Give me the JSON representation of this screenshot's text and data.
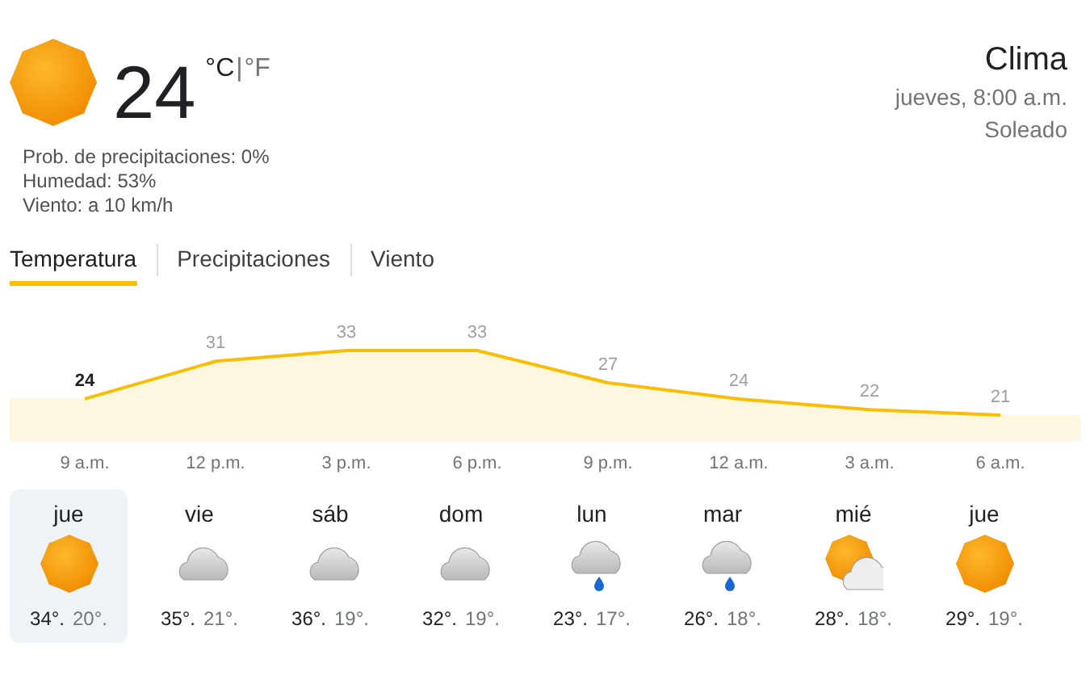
{
  "current": {
    "kind": "sunny",
    "temperature": "24",
    "unit_c": "°C",
    "separator": "|",
    "unit_f": "°F",
    "details": [
      "Prob. de precipitaciones: 0%",
      "Humedad: 53%",
      "Viento: a 10 km/h"
    ]
  },
  "location": {
    "title": "Clima",
    "time": "jueves, 8:00 a.m.",
    "condition": "Soleado"
  },
  "tabs": [
    {
      "label": "Temperatura",
      "selected": true
    },
    {
      "label": "Precipitaciones",
      "selected": false
    },
    {
      "label": "Viento",
      "selected": false
    }
  ],
  "chart_data": {
    "type": "area",
    "categories": [
      "9 a.m.",
      "12 p.m.",
      "3 p.m.",
      "6 p.m.",
      "9 p.m.",
      "12 a.m.",
      "3 a.m.",
      "6 a.m."
    ],
    "series": [
      {
        "color": "#fbbc04",
        "values": [
          24,
          31,
          33,
          33,
          27,
          24,
          22,
          21
        ]
      }
    ],
    "data_labels": true
  },
  "days": [
    {
      "day": "jue",
      "kind": "sunny",
      "high": "34°.",
      "low": "20°.",
      "selected": true
    },
    {
      "day": "vie",
      "kind": "cloudy",
      "high": "35°.",
      "low": "21°.",
      "selected": false
    },
    {
      "day": "sáb",
      "kind": "cloudy",
      "high": "36°.",
      "low": "19°.",
      "selected": false
    },
    {
      "day": "dom",
      "kind": "cloudy",
      "high": "32°.",
      "low": "19°.",
      "selected": false
    },
    {
      "day": "lun",
      "kind": "rain",
      "high": "23°.",
      "low": "17°.",
      "selected": false
    },
    {
      "day": "mar",
      "kind": "rain",
      "high": "26°.",
      "low": "18°.",
      "selected": false
    },
    {
      "day": "mié",
      "kind": "partly",
      "high": "28°.",
      "low": "18°.",
      "selected": false
    },
    {
      "day": "jue",
      "kind": "sunny",
      "high": "29°.",
      "low": "19°.",
      "selected": false
    }
  ]
}
